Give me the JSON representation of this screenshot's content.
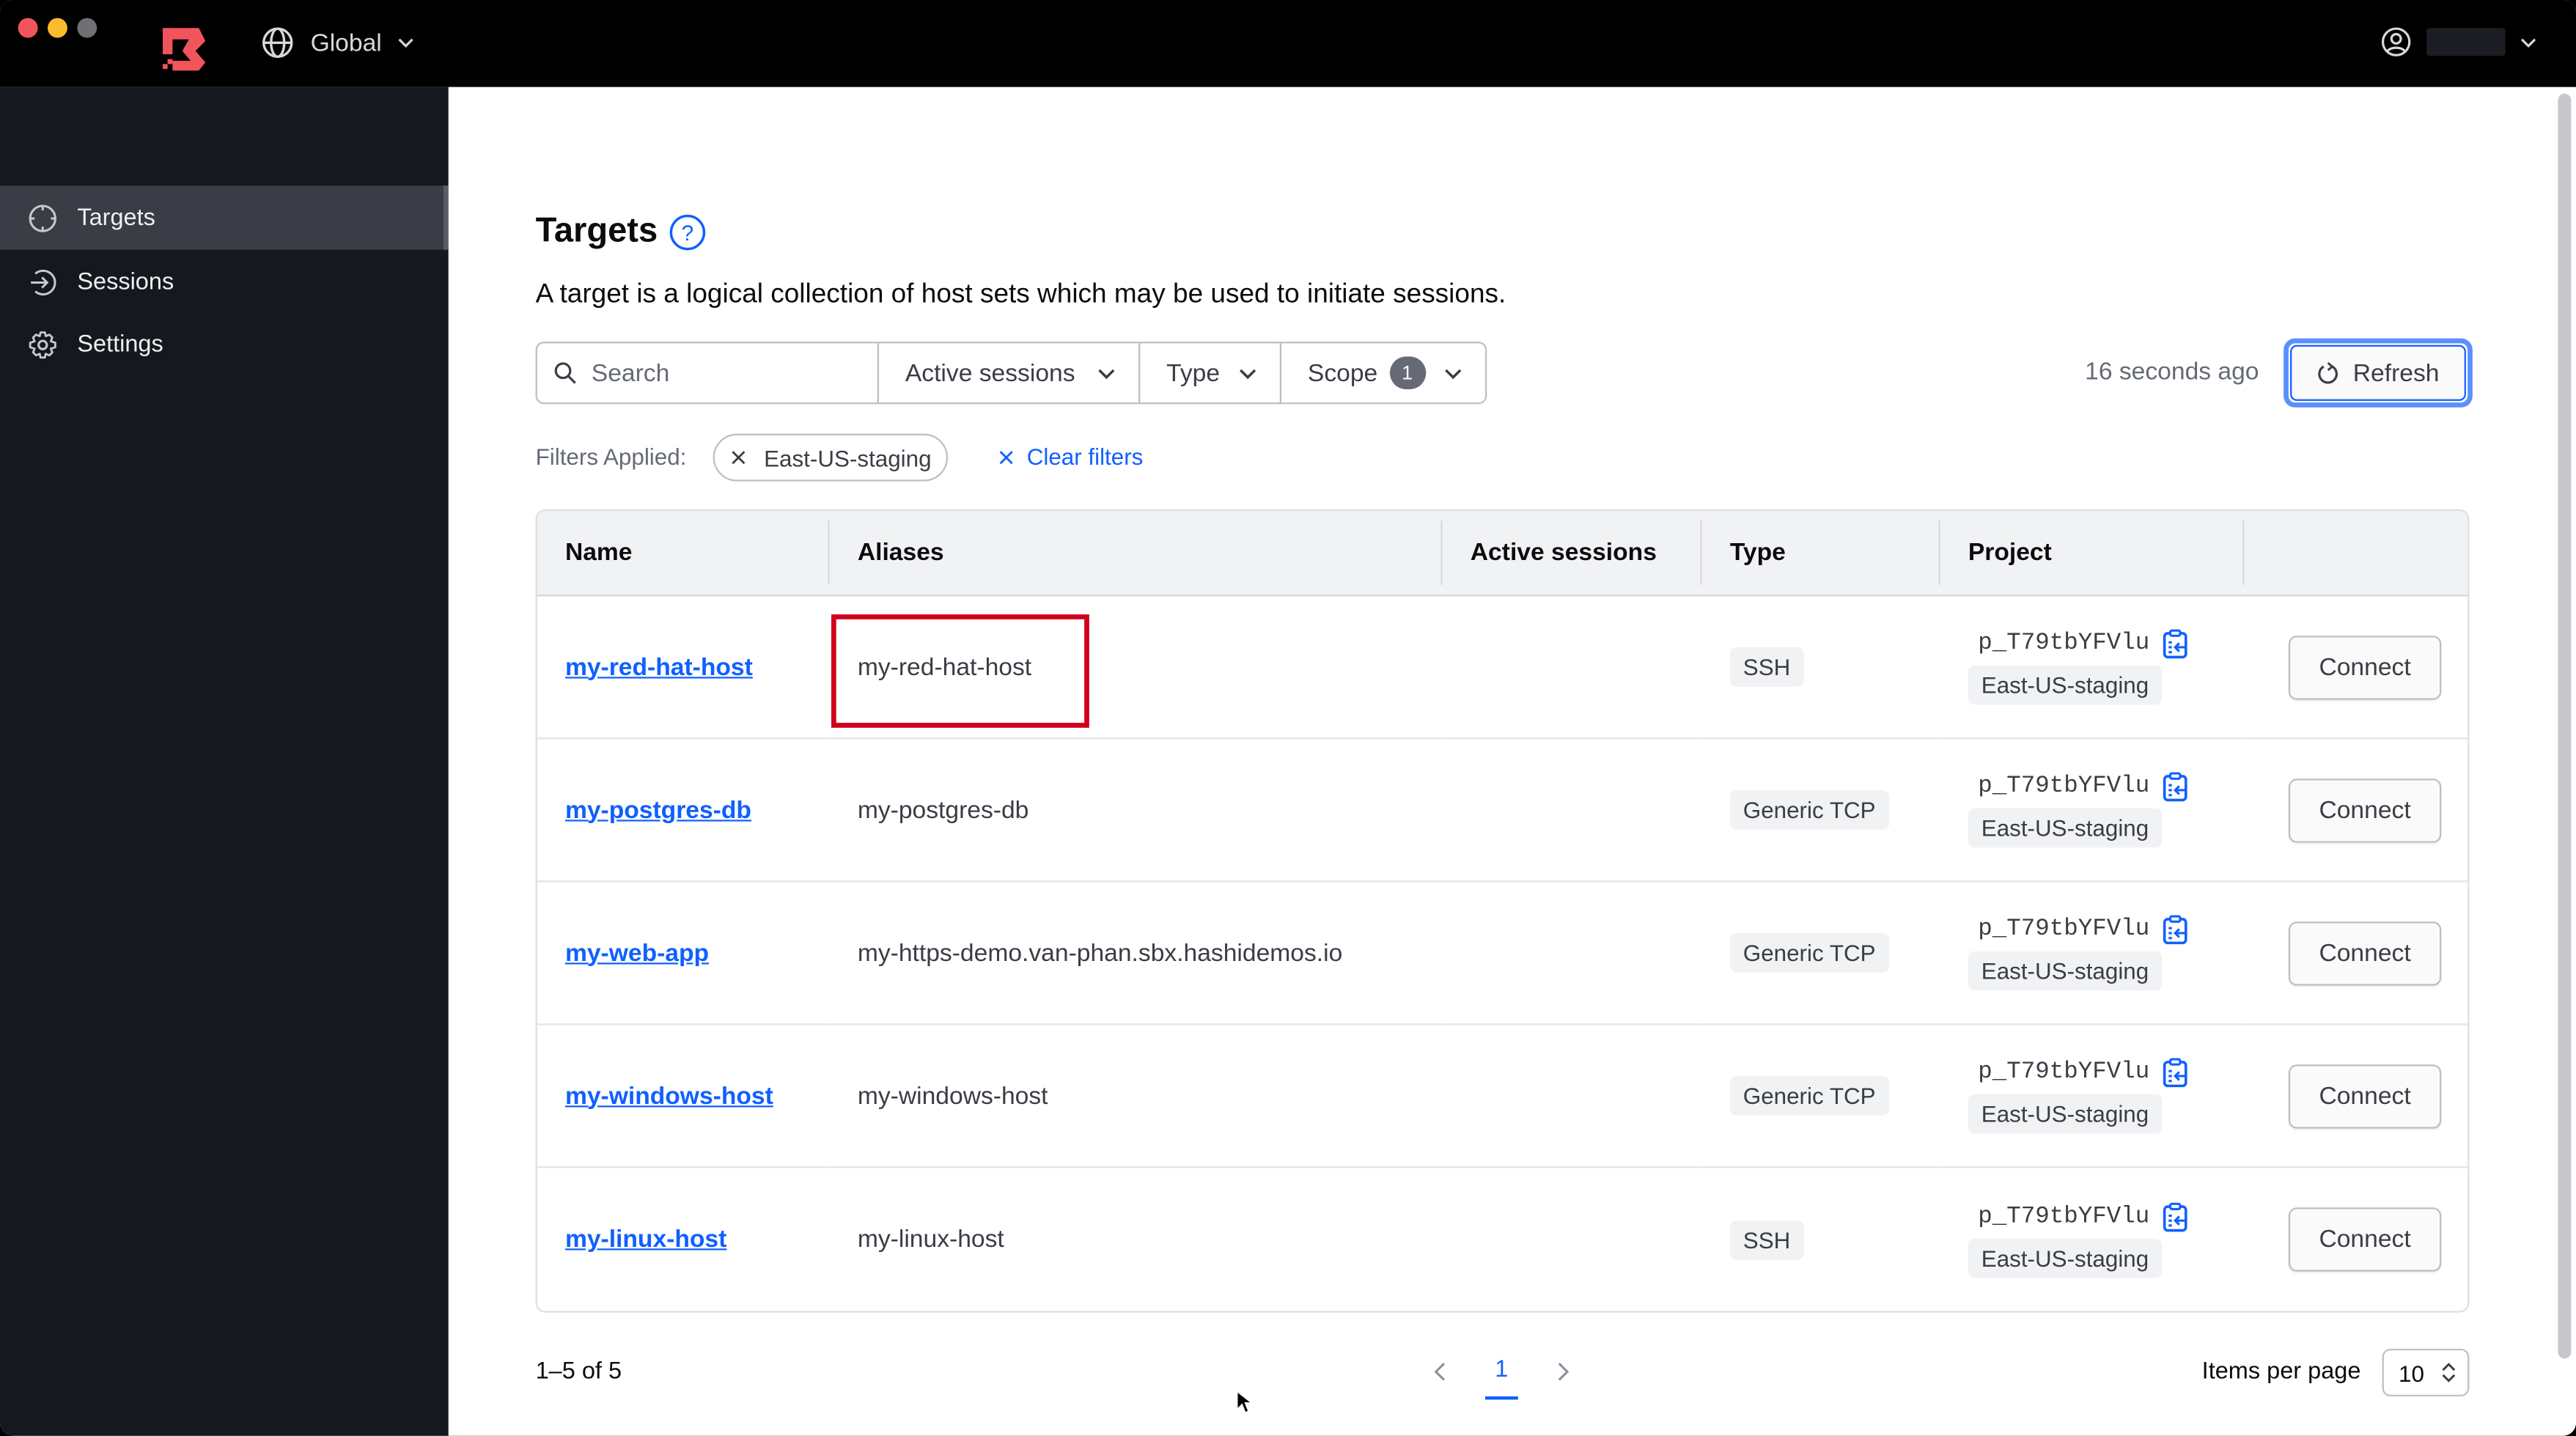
{
  "window": {
    "controls": [
      "close",
      "minimize",
      "zoom"
    ]
  },
  "topbar": {
    "logo": "boundary-logo",
    "scope_label": "Global",
    "scope_icon": "globe-icon",
    "user_icon": "user-circle-icon"
  },
  "sidebar": {
    "items": [
      {
        "label": "Targets",
        "icon": "target-icon",
        "active": true
      },
      {
        "label": "Sessions",
        "icon": "sessions-icon"
      },
      {
        "label": "Settings",
        "icon": "gear-icon"
      }
    ]
  },
  "page": {
    "title": "Targets",
    "description": "A target is a logical collection of host sets which may be used to initiate sessions."
  },
  "filters": {
    "search_placeholder": "Search",
    "active_sessions": "Active sessions",
    "type": "Type",
    "scope": "Scope",
    "scope_count": "1",
    "last_refreshed": "16 seconds ago",
    "refresh_label": "Refresh",
    "applied_label": "Filters Applied:",
    "applied": [
      "East-US-staging"
    ],
    "clear_label": "Clear filters"
  },
  "table": {
    "columns": [
      "Name",
      "Aliases",
      "Active sessions",
      "Type",
      "Project",
      ""
    ],
    "rows": [
      {
        "name": "my-red-hat-host",
        "alias": "my-red-hat-host",
        "active_sessions": "",
        "type": "SSH",
        "project_id": "p_T79tbYFVlu",
        "project_name": "East-US-staging",
        "action": "Connect",
        "highlighted": true
      },
      {
        "name": "my-postgres-db",
        "alias": "my-postgres-db",
        "active_sessions": "",
        "type": "Generic TCP",
        "project_id": "p_T79tbYFVlu",
        "project_name": "East-US-staging",
        "action": "Connect"
      },
      {
        "name": "my-web-app",
        "alias": "my-https-demo.van-phan.sbx.hashidemos.io",
        "active_sessions": "",
        "type": "Generic TCP",
        "project_id": "p_T79tbYFVlu",
        "project_name": "East-US-staging",
        "action": "Connect"
      },
      {
        "name": "my-windows-host",
        "alias": "my-windows-host",
        "active_sessions": "",
        "type": "Generic TCP",
        "project_id": "p_T79tbYFVlu",
        "project_name": "East-US-staging",
        "action": "Connect"
      },
      {
        "name": "my-linux-host",
        "alias": "my-linux-host",
        "active_sessions": "",
        "type": "SSH",
        "project_id": "p_T79tbYFVlu",
        "project_name": "East-US-staging",
        "action": "Connect"
      }
    ]
  },
  "pagination": {
    "summary": "1–5 of 5",
    "current_page": "1",
    "items_per_page_label": "Items per page",
    "items_per_page": "10"
  },
  "colors": {
    "accent": "#1060ff",
    "highlight": "#d0021b",
    "logo": "#f2545b"
  }
}
